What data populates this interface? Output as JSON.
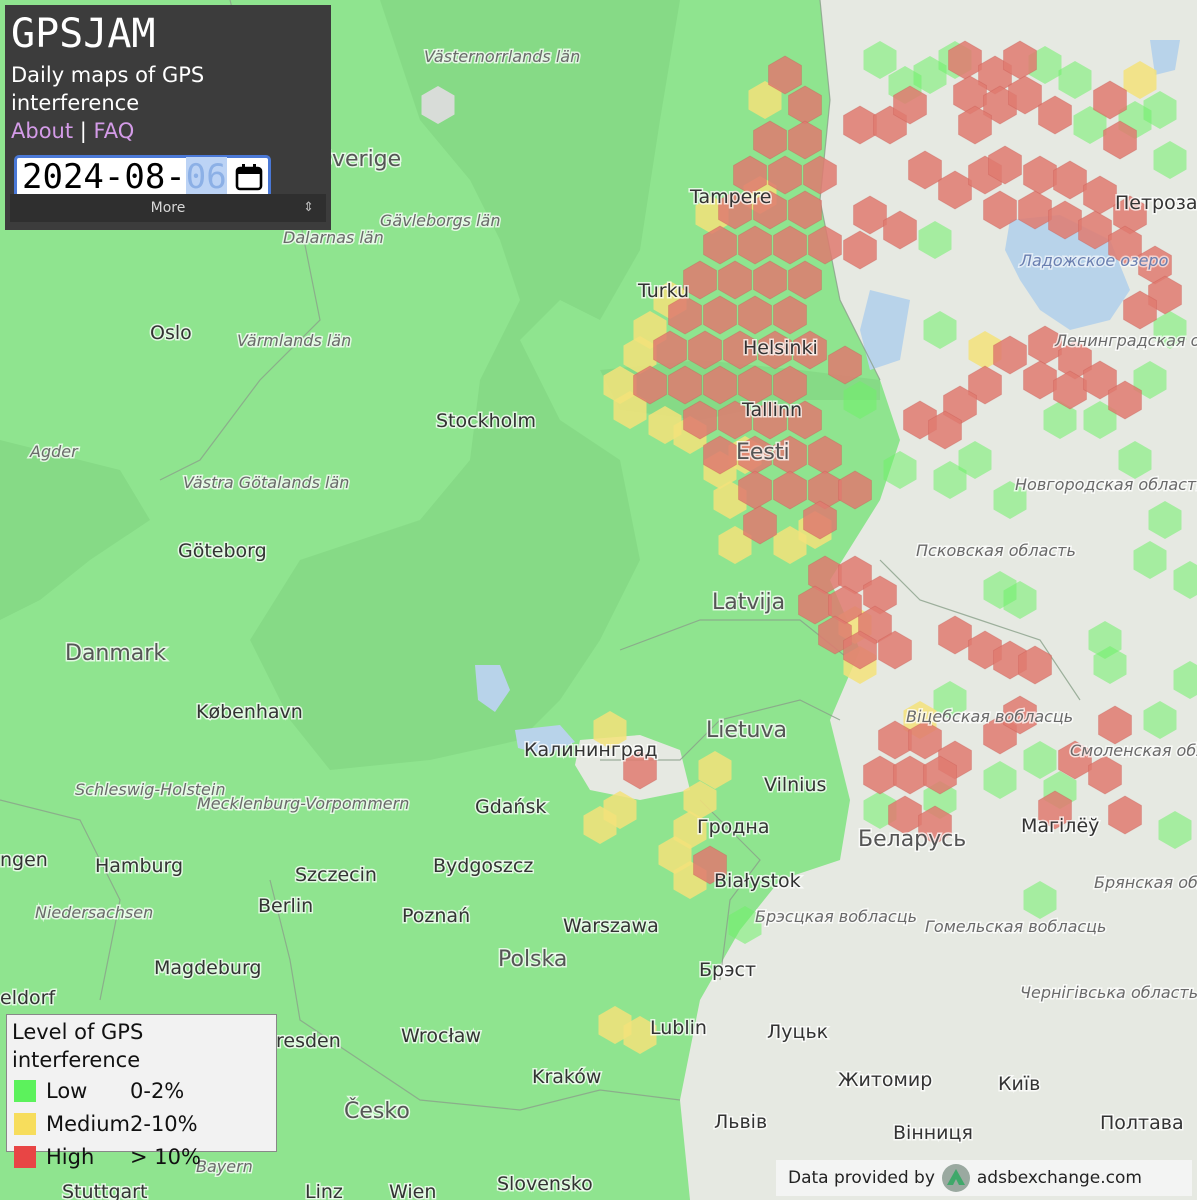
{
  "header": {
    "title": "GPSJAM",
    "subtitle": "Daily maps of GPS interference",
    "about_link": "About",
    "separator": "|",
    "faq_link": "FAQ",
    "date_prefix": "2024-08-",
    "date_day": "06",
    "more_label": "More",
    "more_icon": "updown-arrows-icon"
  },
  "legend": {
    "title": "Level of GPS interference",
    "items": [
      {
        "name": "Low",
        "range": "0-2%",
        "color": "#5cf25c"
      },
      {
        "name": "Medium",
        "range": "2-10%",
        "color": "#f7dd5c"
      },
      {
        "name": "High",
        "range": "> 10%",
        "color": "#e84545"
      }
    ]
  },
  "attribution": {
    "text": "Data provided by",
    "provider": "adsbexchange.com",
    "icon": "adsbexchange-logo-icon"
  },
  "colors": {
    "land_low": "#8fe48f",
    "sea": "#89dd89",
    "no_data_land": "#e8ebe4",
    "medium": "#f3e27a",
    "high": "#df7a70"
  },
  "map_labels": {
    "countries": [
      "Sverige",
      "Danmark",
      "Latvija",
      "Lietuva",
      "Polska",
      "Беларусь",
      "Eesti",
      "Česko"
    ],
    "cities": [
      "Tampere",
      "Turku",
      "Helsinki",
      "Tallinn",
      "Stockholm",
      "Oslo",
      "Göteborg",
      "København",
      "Калининград",
      "Gdańsk",
      "Vilnius",
      "Гродна",
      "Białystok",
      "Warszawa",
      "Bydgoszcz",
      "Szczecin",
      "Hamburg",
      "Berlin",
      "Poznań",
      "Magdeburg",
      "Wrocław",
      "Kraków",
      "Lublin",
      "Брэст",
      "Луцьк",
      "Житомир",
      "Київ",
      "Львів",
      "Вінниця",
      "Полтава",
      "Магілёў",
      "Петроза",
      "Stuttgart",
      "Linz",
      "Wien",
      "Slovensko",
      "ngen",
      "eldorf",
      "resden"
    ],
    "regions": [
      "Västernorrlands län",
      "Gävleborgs län",
      "Dalarnas län",
      "Värmlands län",
      "Agder",
      "Västra Götalands län",
      "Schleswig-Holstein",
      "Mecklenburg-Vorpommern",
      "Niedersachsen",
      "Bayern",
      "Новгородская область",
      "Псковская область",
      "Ленинградская область",
      "Віцебская вобласць",
      "Смоленская область",
      "Брянская область",
      "Брэсцкая вобласць",
      "Гомельская вобласць",
      "Чернігівська область"
    ],
    "water": [
      "Ладожское озеро"
    ]
  }
}
